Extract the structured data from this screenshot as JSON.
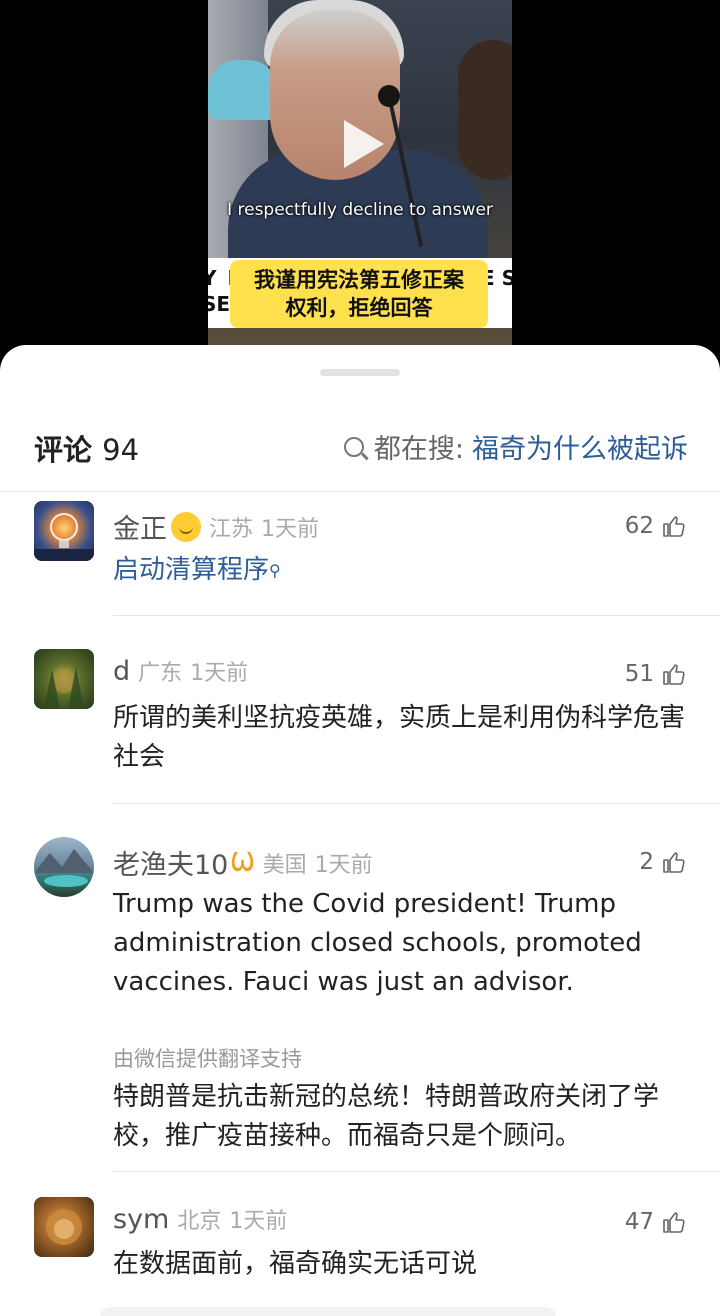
{
  "video": {
    "subtitle_en": "I respectfully decline to answer",
    "subtitle_cn_line1": "我谨用宪法第五修正案",
    "subtitle_cn_line2": "权利，拒绝回答",
    "desk_sign_line1": "Y F",
    "desk_sign_line2": "SEC",
    "desk_sign_right": "E S",
    "play_icon": "play-icon"
  },
  "header": {
    "comments_label": "评论",
    "comments_count": "94",
    "search_prefix": "都在搜:",
    "search_query": "福奇为什么被起诉",
    "search_icon": "search-icon"
  },
  "comments": [
    {
      "username": "金正",
      "badge": "hug-emoji-icon",
      "region": "江苏",
      "time": "1天前",
      "likes": "62",
      "content": "启动清算程序",
      "content_link": true
    },
    {
      "username": "d",
      "region": "广东",
      "time": "1天前",
      "likes": "51",
      "content": "所谓的美利坚抗疫英雄，实质上是利用伪科学危害社会"
    },
    {
      "username": "老渔夫10",
      "badge": "vip-badge-icon",
      "region": "美国",
      "time": "1天前",
      "likes": "2",
      "content": "Trump was the Covid president! Trump administration closed schools, promoted vaccines.  Fauci was just an advisor.",
      "translate_note": "由微信提供翻译支持",
      "translation": "特朗普是抗击新冠的总统！特朗普政府关闭了学校，推广疫苗接种。而福奇只是个顾问。"
    },
    {
      "username": "sym",
      "region": "北京",
      "time": "1天前",
      "likes": "47",
      "content": "在数据面前，福奇确实无话可说"
    }
  ],
  "colors": {
    "link": "#2e5e97",
    "subtitle_bg": "#ffe14d",
    "vip": "#f0a020"
  }
}
